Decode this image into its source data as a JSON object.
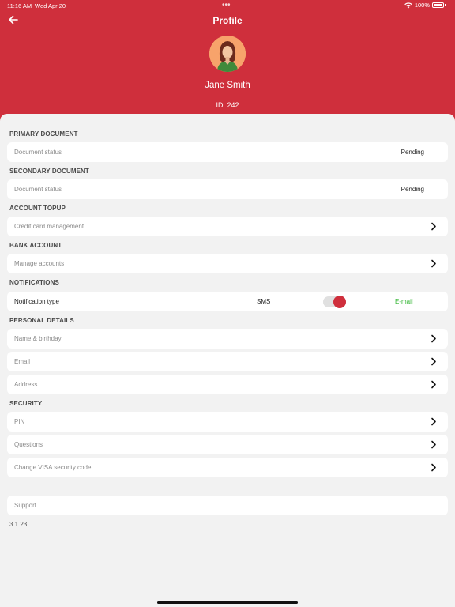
{
  "status_bar": {
    "time": "11:16 AM",
    "date": "Wed Apr 20",
    "battery": "100%"
  },
  "header": {
    "title": "Profile",
    "name": "Jane Smith",
    "id_label": "ID: 242"
  },
  "sections": {
    "primary_document": {
      "label": "PRIMARY DOCUMENT",
      "row_label": "Document status",
      "row_value": "Pending"
    },
    "secondary_document": {
      "label": "SECONDARY DOCUMENT",
      "row_label": "Document status",
      "row_value": "Pending"
    },
    "account_topup": {
      "label": "ACCOUNT TOPUP",
      "row_label": "Credit card management"
    },
    "bank_account": {
      "label": "BANK ACCOUNT",
      "row_label": "Manage accounts"
    },
    "notifications": {
      "label": "NOTIFICATIONS",
      "row_label": "Notification type",
      "option_sms": "SMS",
      "option_email": "E-mail",
      "selected": "E-mail"
    },
    "personal_details": {
      "label": "PERSONAL DETAILS",
      "rows": [
        "Name & birthday",
        "Email",
        "Address"
      ]
    },
    "security": {
      "label": "SECURITY",
      "rows": [
        "PIN",
        "Questions",
        "Change VISA security code"
      ]
    },
    "support": {
      "row_label": "Support"
    }
  },
  "version": "3.1.23",
  "colors": {
    "brand_red": "#cf2f3c",
    "email_green": "#31b531",
    "background": "#f2f2f2"
  },
  "icons": {
    "back": "arrow-left-icon",
    "chevron": "chevron-right-icon",
    "avatar": "user-avatar"
  }
}
